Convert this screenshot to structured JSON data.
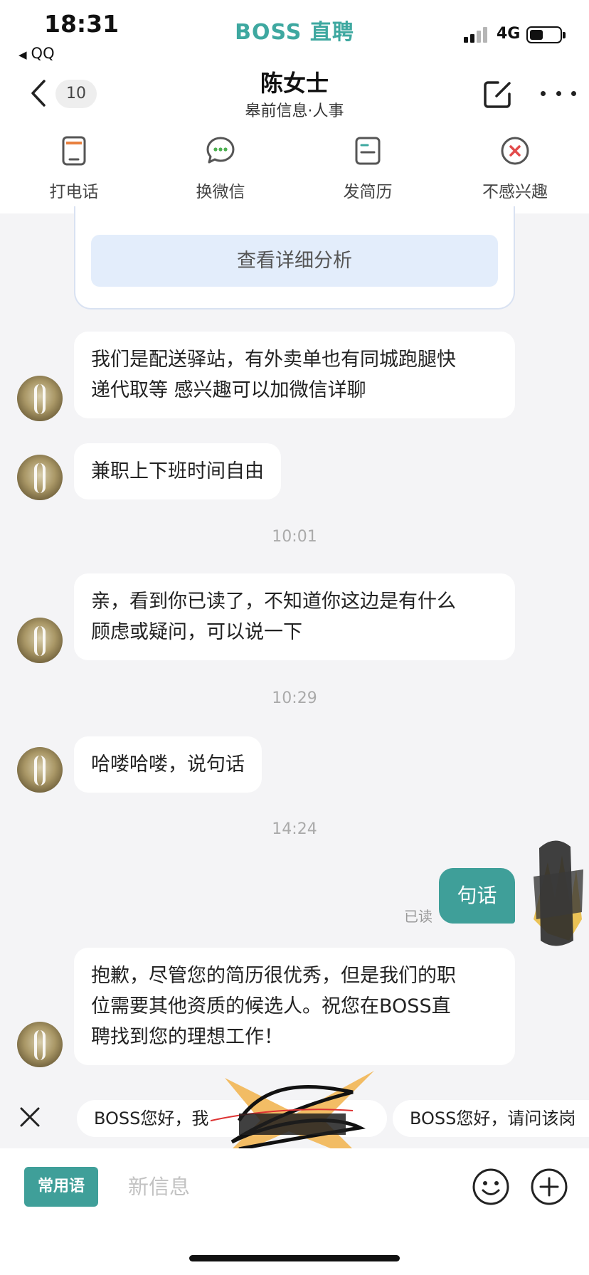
{
  "status_bar": {
    "time": "18:31",
    "back_app": "QQ",
    "brand": "BOSS 直聘",
    "network": "4G"
  },
  "header": {
    "unread_count": "10",
    "name": "陈女士",
    "subtitle": "皋前信息·人事"
  },
  "actions": [
    {
      "label": "打电话",
      "icon": "phone-icon"
    },
    {
      "label": "换微信",
      "icon": "wechat-icon"
    },
    {
      "label": "发简历",
      "icon": "resume-icon"
    },
    {
      "label": "不感兴趣",
      "icon": "not-interested-icon"
    }
  ],
  "card": {
    "button_label": "查看详细分析"
  },
  "messages": [
    {
      "sender": "other",
      "text_lines": [
        "我们是配送驿站，有外卖单也有同城跑腿快",
        "递代取等 感兴趣可以加微信详聊"
      ]
    },
    {
      "sender": "other",
      "text_lines": [
        "兼职上下班时间自由"
      ]
    },
    {
      "type": "time",
      "text": "10:01"
    },
    {
      "sender": "other",
      "text_lines": [
        "亲，看到你已读了，不知道你这边是有什么",
        "顾虑或疑问，可以说一下"
      ]
    },
    {
      "type": "time",
      "text": "10:29"
    },
    {
      "sender": "other",
      "text_lines": [
        "哈喽哈喽，说句话"
      ]
    },
    {
      "type": "time",
      "text": "14:24"
    },
    {
      "sender": "me",
      "text_lines": [
        "句话"
      ],
      "status": "已读"
    },
    {
      "sender": "other",
      "text_lines": [
        "抱歉，尽管您的简历很优秀，但是我们的职",
        "位需要其他资质的候选人。祝您在BOSS直",
        "聘找到您的理想工作！"
      ]
    }
  ],
  "quick_phrases": [
    "BOSS您好，我",
    "BOSS您好，请问该岗"
  ],
  "input": {
    "phrases_button": "常用语",
    "placeholder": "新信息"
  },
  "colors": {
    "brand": "#3ea8a0",
    "my_bubble": "#3f9f99",
    "background": "#f4f4f6"
  }
}
